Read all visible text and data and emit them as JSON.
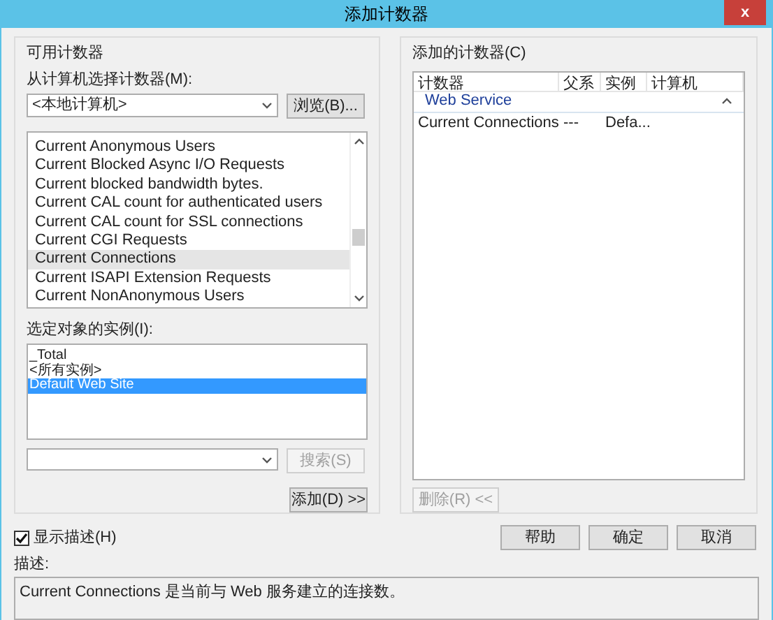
{
  "window": {
    "title": "添加计数器",
    "close": "x"
  },
  "available": {
    "title": "可用计数器",
    "computer_label": "从计算机选择计数器(M):",
    "computer_value": "<本地计算机>",
    "browse_button": "浏览(B)...",
    "counters": [
      {
        "label": "Current Anonymous Users",
        "selected": false
      },
      {
        "label": "Current Blocked Async I/O Requests",
        "selected": false
      },
      {
        "label": "Current blocked bandwidth bytes.",
        "selected": false
      },
      {
        "label": "Current CAL count for authenticated users",
        "selected": false
      },
      {
        "label": "Current CAL count for SSL connections",
        "selected": false
      },
      {
        "label": "Current CGI Requests",
        "selected": false
      },
      {
        "label": "Current Connections",
        "selected": true
      },
      {
        "label": "Current ISAPI Extension Requests",
        "selected": false
      },
      {
        "label": "Current NonAnonymous Users",
        "selected": false
      }
    ],
    "instances_label": "选定对象的实例(I):",
    "instances": [
      {
        "label": "_Total",
        "selected": false
      },
      {
        "label": "<所有实例>",
        "selected": false
      },
      {
        "label": "Default Web Site",
        "selected": true
      }
    ],
    "search_button": {
      "label": "搜索(S)",
      "disabled": true
    },
    "add_button": "添加(D) >>"
  },
  "added": {
    "title": "添加的计数器(C)",
    "columns": [
      "计数器",
      "父系",
      "实例",
      "计算机"
    ],
    "groups": [
      {
        "name": "Web Service",
        "expanded": true,
        "rows": [
          {
            "counter": "Current Connections",
            "parent": "---",
            "instance": "Defa..."
          }
        ]
      }
    ],
    "remove_button": {
      "label": "删除(R) <<",
      "disabled": true
    }
  },
  "show_description": {
    "label": "显示描述(H)",
    "checked": true
  },
  "buttons": [
    "帮助",
    "确定",
    "取消"
  ],
  "description": {
    "label": "描述:",
    "text": "Current Connections 是当前与 Web 服务建立的连接数。"
  }
}
